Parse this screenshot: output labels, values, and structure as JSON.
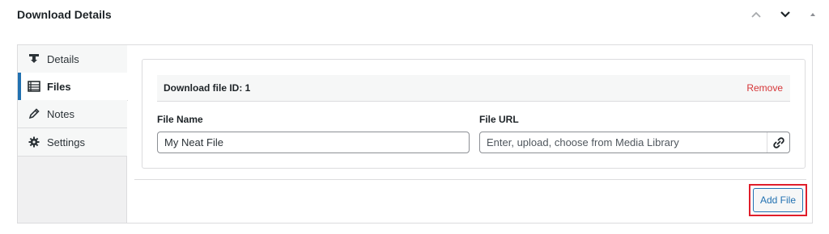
{
  "metabox": {
    "title": "Download Details",
    "move_up_icon": "chevron-up-icon",
    "move_down_icon": "chevron-down-icon",
    "toggle_icon": "triangle-up-icon"
  },
  "tabs": [
    {
      "label": "Details",
      "icon": "download-icon",
      "active": false
    },
    {
      "label": "Files",
      "icon": "list-icon",
      "active": true
    },
    {
      "label": "Notes",
      "icon": "pencil-icon",
      "active": false
    },
    {
      "label": "Settings",
      "icon": "gear-icon",
      "active": false
    }
  ],
  "file": {
    "heading": "Download file ID: 1",
    "remove_label": "Remove",
    "name_label": "File Name",
    "name_value": "My Neat File",
    "url_label": "File URL",
    "url_placeholder": "Enter, upload, choose from Media Library",
    "url_value": "",
    "link_icon": "link-icon"
  },
  "actions": {
    "add_file_label": "Add File"
  },
  "colors": {
    "accent": "#2271b1",
    "remove": "#d63638",
    "highlight": "#e01e2b"
  }
}
